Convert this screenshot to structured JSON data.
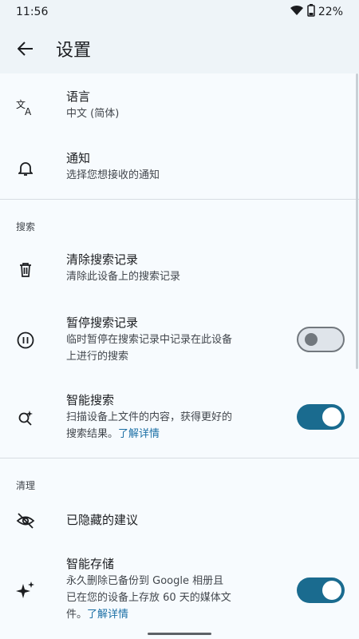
{
  "status": {
    "time": "11:56",
    "battery": "22%"
  },
  "appbar": {
    "title": "设置"
  },
  "items": [
    {
      "title": "语言",
      "subtitle": "中文 (简体)"
    },
    {
      "title": "通知",
      "subtitle": "选择您想接收的通知"
    }
  ],
  "sections": {
    "search": "搜索",
    "cleanup": "清理"
  },
  "search_items": {
    "clear": {
      "title": "清除搜索记录",
      "subtitle": "清除此设备上的搜索记录"
    },
    "pause": {
      "title": "暂停搜索记录",
      "subtitle_line1": "临时暂停在搜索记录中记录在此设备",
      "subtitle_line2": "上进行的搜索",
      "toggle_on": false
    },
    "smart": {
      "title": "智能搜索",
      "subtitle_line1": "扫描设备上文件的内容，获得更好的",
      "subtitle_line2": "搜索结果。",
      "link": "了解详情",
      "toggle_on": true
    }
  },
  "cleanup_items": {
    "hidden": {
      "title": "已隐藏的建议"
    },
    "storage": {
      "title": "智能存储",
      "subtitle_line1": "永久删除已备份到 Google 相册且",
      "subtitle_line2": "已在您的设备上存放 60 天的媒体文",
      "subtitle_line3": "件。",
      "link": "了解详情",
      "toggle_on": true
    }
  },
  "colors": {
    "accent": "#1a6b8f",
    "link": "#1b6fa5",
    "background": "#eef4f8"
  }
}
